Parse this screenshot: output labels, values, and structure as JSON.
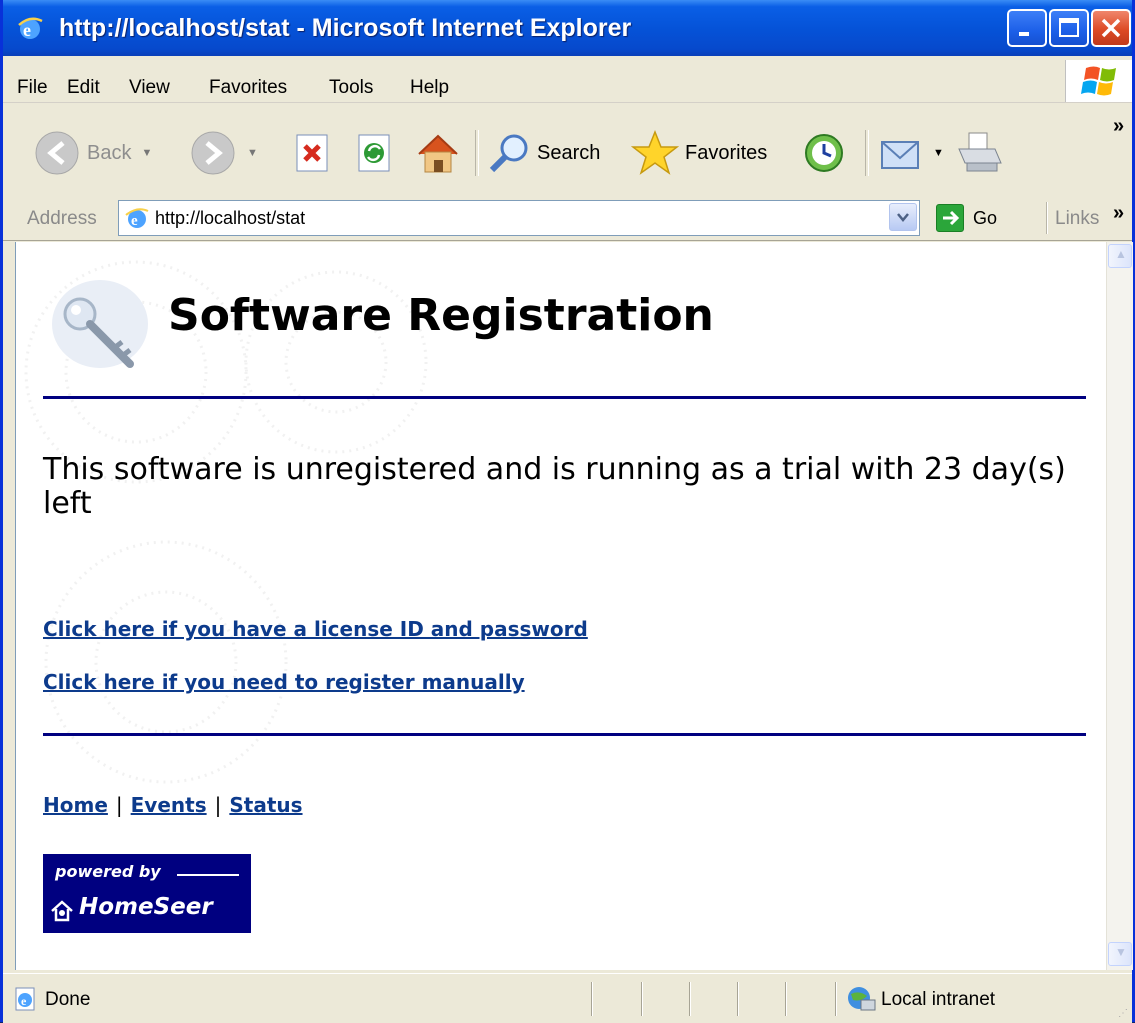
{
  "window": {
    "title": "http://localhost/stat - Microsoft Internet Explorer"
  },
  "menu": {
    "items": [
      "File",
      "Edit",
      "View",
      "Favorites",
      "Tools",
      "Help"
    ]
  },
  "toolbar": {
    "back_label": "Back",
    "search_label": "Search",
    "favorites_label": "Favorites",
    "overflow": "»"
  },
  "address_bar": {
    "label": "Address",
    "url": "http://localhost/stat",
    "go_label": "Go",
    "links_label": "Links",
    "links_overflow": "»"
  },
  "page": {
    "title": "Software Registration",
    "status_message": "This software is unregistered and is running as a trial with 23 day(s) left",
    "links": [
      "Click here if you have a license ID and password",
      "Click here if you need to register manually"
    ],
    "nav": [
      "Home",
      "Events",
      "Status"
    ],
    "nav_separator": "|",
    "logo": {
      "powered_by": "powered by",
      "brand": "HomeSeer"
    }
  },
  "statusbar": {
    "status": "Done",
    "zone": "Local intranet"
  },
  "colors": {
    "rule": "#000080",
    "link": "#0d3b8c",
    "logo_bg": "#000080"
  }
}
